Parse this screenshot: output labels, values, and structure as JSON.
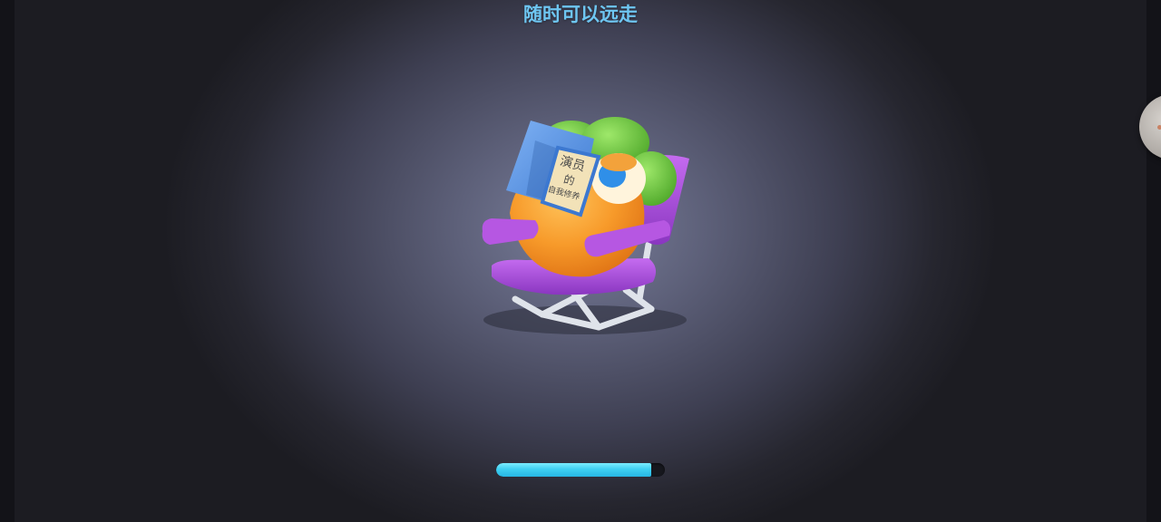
{
  "loading_screen": {
    "title": "随时可以远走",
    "progress": 0.92,
    "mascot": {
      "icon": "carrot-mascot-reading-icon",
      "book_title_lines": [
        "演员",
        "的",
        "自我修养"
      ]
    },
    "floating_button": {
      "icon": "floating-assistant-icon"
    }
  },
  "colors": {
    "title": "#6ec6f2",
    "progress_fill": "#3fd0f2",
    "progress_track": "#16171d",
    "chair": "#a24fd0",
    "carrot_body": "#f79a2a",
    "leaves": "#6cc63a",
    "book": "#4f8fe0"
  }
}
